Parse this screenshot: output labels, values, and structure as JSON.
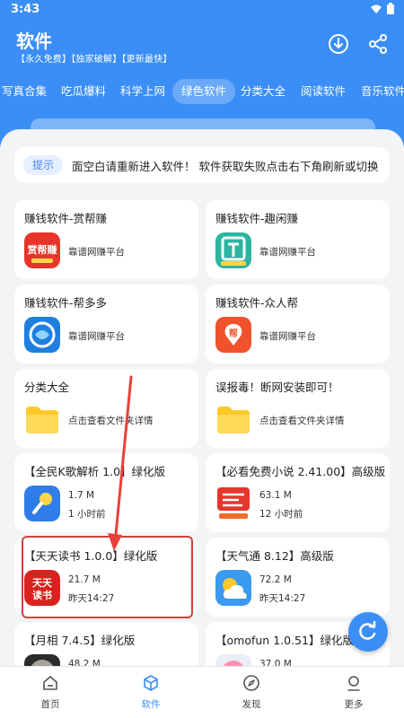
{
  "status": {
    "time": "3:43"
  },
  "header": {
    "title": "软件",
    "subtitle": "【永久免费】【独家破解】【更新最快】"
  },
  "tabs": [
    "写真合集",
    "吃瓜爆料",
    "科学上网",
    "绿色软件",
    "分类大全",
    "阅读软件",
    "音乐软件"
  ],
  "active_tab": "绿色软件",
  "notice": {
    "badge": "提示",
    "text": "面空白请重新进入软件！  软件获取失败点击右下角刷新或切换"
  },
  "cards": [
    {
      "title": "赚钱软件-赏帮赚",
      "desc": "靠谱网赚平台",
      "icon": "shangbangzhuan-app-icon"
    },
    {
      "title": "赚钱软件-趣闲赚",
      "desc": "靠谱网赚平台",
      "icon": "quxianzhuan-app-icon"
    },
    {
      "title": "赚钱软件-帮多多",
      "desc": "靠谱网赚平台",
      "icon": "bangduoduo-app-icon"
    },
    {
      "title": "赚钱软件-众人帮",
      "desc": "靠谱网赚平台",
      "icon": "zhongrenbang-app-icon"
    },
    {
      "title": "分类大全",
      "desc": "点击查看文件夹详情",
      "icon": "folder-icon"
    },
    {
      "title": "误报毒！断网安装即可！",
      "desc": "点击查看文件夹详情",
      "icon": "folder-icon"
    },
    {
      "title": "【全民K歌解析 1.0】绿化版",
      "size": "1.7 M",
      "time": "1 小时前",
      "icon": "microphone-app-icon"
    },
    {
      "title": "【必看免费小说 2.41.00】高级版",
      "size": "63.1 M",
      "time": "12 小时前",
      "icon": "novel-app-icon"
    },
    {
      "title": "【天天读书 1.0.0】绿化版",
      "size": "21.7 M",
      "time": "昨天14:27",
      "icon": "tiantian-dushu-app-icon",
      "app_text": "天天读书"
    },
    {
      "title": "【天气通 8.12】高级版",
      "size": "72.2 M",
      "time": "昨天14:27",
      "icon": "weather-app-icon"
    },
    {
      "title": "【月相 7.4.5】绿化版",
      "size": "48.2 M",
      "time": "",
      "icon": "moon-app-icon"
    },
    {
      "title": "【omofun 1.0.51】绿化版",
      "size": "37.0 M",
      "time": "",
      "icon": "omofun-app-icon"
    }
  ],
  "bottom_nav": [
    {
      "label": "首页",
      "icon": "home-icon"
    },
    {
      "label": "软件",
      "icon": "box-icon"
    },
    {
      "label": "发现",
      "icon": "compass-icon"
    },
    {
      "label": "更多",
      "icon": "user-icon"
    }
  ],
  "active_nav": "软件",
  "colors": {
    "primary": "#3a8ef6",
    "highlight": "#d0413a",
    "panel_bg": "#f3f4f6"
  }
}
